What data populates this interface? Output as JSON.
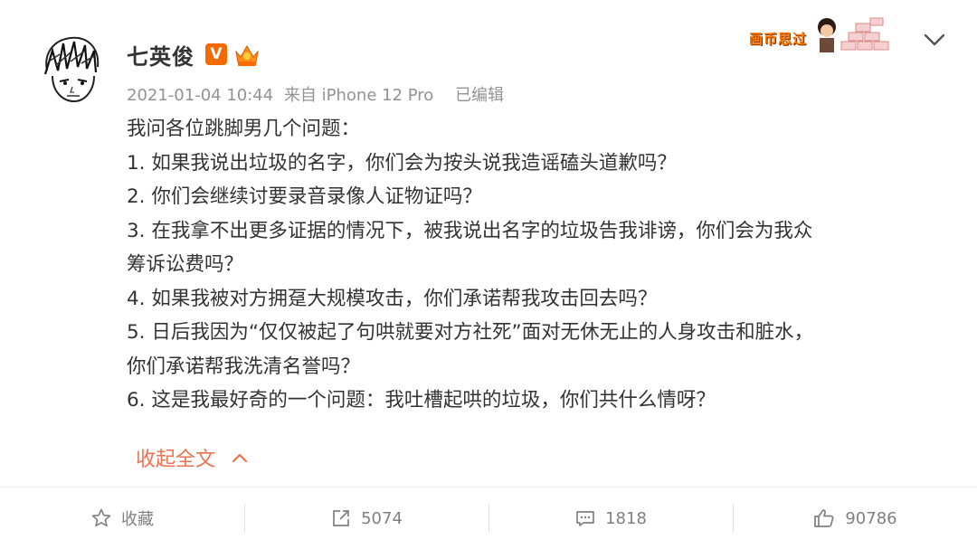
{
  "post": {
    "username": "七英俊",
    "verified_badge": "V",
    "badges": [
      "verified-v-icon",
      "crown-badge-icon"
    ],
    "timestamp": "2021-01-04 10:44",
    "source": "来自 iPhone 12 Pro",
    "edited": "已编辑",
    "decoration_text": "画币思过",
    "content": {
      "intro": "我问各位跳脚男几个问题：",
      "q1": "1. 如果我说出垃圾的名字，你们会为按头说我造谣磕头道歉吗？",
      "q2": "2. 你们会继续讨要录音录像人证物证吗？",
      "q3a": "3. 在我拿不出更多证据的情况下，被我说出名字的垃圾告我诽谤，你们会为我众",
      "q3b": "筹诉讼费吗？",
      "q4": "4. 如果我被对方拥趸大规模攻击，你们承诺帮我攻击回去吗？",
      "q5a": "5. 日后我因为“仅仅被起了句哄就要对方社死”面对无休无止的人身攻击和脏水，",
      "q5b": "你们承诺帮我洗清名誉吗？",
      "q6": "6. 这是我最好奇的一个问题：我吐槽起哄的垃圾，你们共什么情呀？"
    },
    "collapse_label": "收起全文"
  },
  "actions": {
    "favorite_label": "收藏",
    "repost_count": "5074",
    "comment_count": "1818",
    "like_count": "90786"
  },
  "colors": {
    "accent": "#eb7350",
    "badge_orange": "#f56a00",
    "meta_gray": "#939393"
  }
}
